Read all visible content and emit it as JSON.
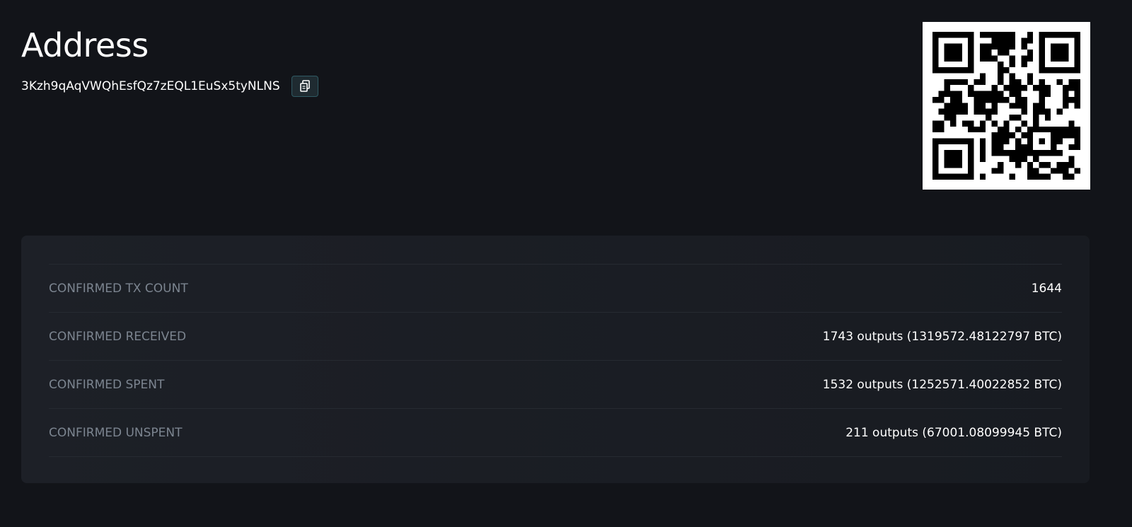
{
  "page": {
    "title": "Address",
    "address": "3Kzh9qAqVWQhEsfQz7zEQL1EuSx5tyNLNS",
    "copy_icon": "copy-icon",
    "qr_icon": "qr-code"
  },
  "stats": [
    {
      "label": "CONFIRMED TX COUNT",
      "value": "1644"
    },
    {
      "label": "CONFIRMED RECEIVED",
      "value": "1743 outputs (1319572.48122797 BTC)"
    },
    {
      "label": "CONFIRMED SPENT",
      "value": "1532 outputs (1252571.40022852 BTC)"
    },
    {
      "label": "CONFIRMED UNSPENT",
      "value": "211 outputs (67001.08099945 BTC)"
    }
  ],
  "colors": {
    "background": "#121419",
    "card": "#1b1e24",
    "label": "#7c8590",
    "text": "#ffffff",
    "copy_border": "#2f5a63"
  }
}
